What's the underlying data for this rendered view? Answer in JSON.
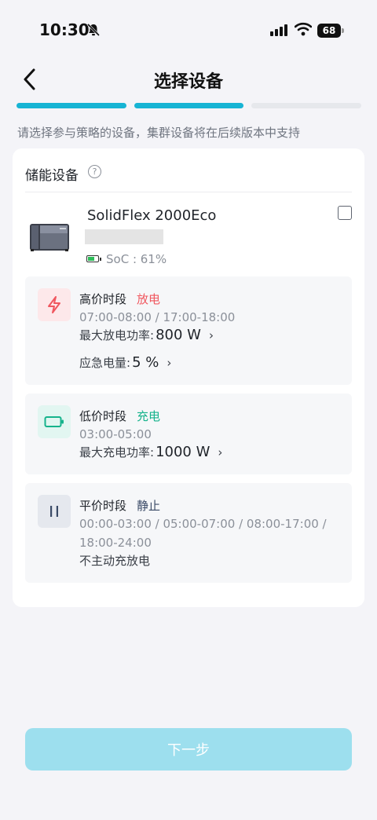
{
  "status_bar": {
    "time": "10:30",
    "battery": "68"
  },
  "header": {
    "title": "选择设备"
  },
  "stepper": {
    "steps": [
      true,
      true,
      false
    ]
  },
  "hint": "请选择参与策略的设备，集群设备将在后续版本中支持",
  "section": {
    "title": "储能设备"
  },
  "device": {
    "name": "SolidFlex 2000Eco",
    "soc_label": "SoC : 61%",
    "soc": 0.61
  },
  "periods": [
    {
      "title": "高价时段",
      "tag": "放电",
      "tag_color": "#f0575f",
      "time": "07:00-08:00 / 17:00-18:00",
      "power_label": "最大放电功率:",
      "power_value": "800 W",
      "reserve_label": "应急电量:",
      "reserve_value": "5 %"
    },
    {
      "title": "低价时段",
      "tag": "充电",
      "tag_color": "#16b38c",
      "time": "03:00-05:00",
      "power_label": "最大充电功率:",
      "power_value": "1000 W"
    },
    {
      "title": "平价时段",
      "tag": "静止",
      "tag_color": "#3a4a66",
      "time_line1": "00:00-03:00 / 05:00-07:00 / 08:00-17:00 /",
      "time_line2": "18:00-24:00",
      "note": "不主动充放电"
    }
  ],
  "footer": {
    "next_label": "下一步"
  }
}
